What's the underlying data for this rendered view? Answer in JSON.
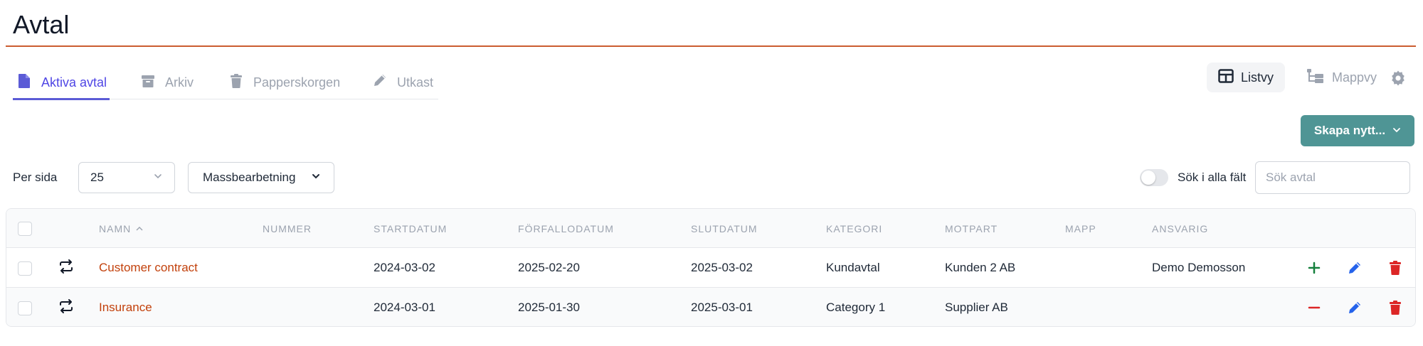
{
  "page": {
    "title": "Avtal"
  },
  "tabs": [
    {
      "label": "Aktiva avtal",
      "icon": "file-icon",
      "active": true
    },
    {
      "label": "Arkiv",
      "icon": "archive-icon",
      "active": false
    },
    {
      "label": "Papperskorgen",
      "icon": "trash-icon",
      "active": false
    },
    {
      "label": "Utkast",
      "icon": "pencil-icon",
      "active": false
    }
  ],
  "views": {
    "list_label": "Listvy",
    "folder_label": "Mappvy",
    "settings_icon": "gear-icon"
  },
  "toolbar": {
    "create_label": "Skapa nytt...",
    "per_page_label": "Per sida",
    "per_page_value": "25",
    "bulk_edit_label": "Massbearbetning",
    "search_all_label": "Sök i alla fält",
    "search_all_enabled": false,
    "search_placeholder": "Sök avtal",
    "search_value": ""
  },
  "table": {
    "headers": {
      "name": "NAMN",
      "number": "NUMMER",
      "start": "STARTDATUM",
      "due": "FÖRFALLODATUM",
      "end": "SLUTDATUM",
      "category": "KATEGORI",
      "counterparty": "MOTPART",
      "folder": "MAPP",
      "responsible": "ANSVARIG"
    },
    "sort": {
      "column": "name",
      "direction": "asc"
    },
    "rows": [
      {
        "name": "Customer contract",
        "number": "",
        "start": "2024-03-02",
        "due": "2025-02-20",
        "end": "2025-03-02",
        "category": "Kundavtal",
        "counterparty": "Kunden 2 AB",
        "folder": "",
        "responsible": "Demo Demosson",
        "recurring_icon": "repeat-icon",
        "expand_icon": "plus-icon"
      },
      {
        "name": "Insurance",
        "number": "",
        "start": "2024-03-01",
        "due": "2025-01-30",
        "end": "2025-03-01",
        "category": "Category 1",
        "counterparty": "Supplier AB",
        "folder": "",
        "responsible": "",
        "recurring_icon": "repeat-icon",
        "expand_icon": "minus-icon"
      }
    ]
  },
  "colors": {
    "accent": "#5b5bd6",
    "brand_orange": "#c2410c",
    "primary_button": "#4f9595",
    "edit_blue": "#2563eb",
    "delete_red": "#dc2626",
    "add_green": "#15803d"
  }
}
